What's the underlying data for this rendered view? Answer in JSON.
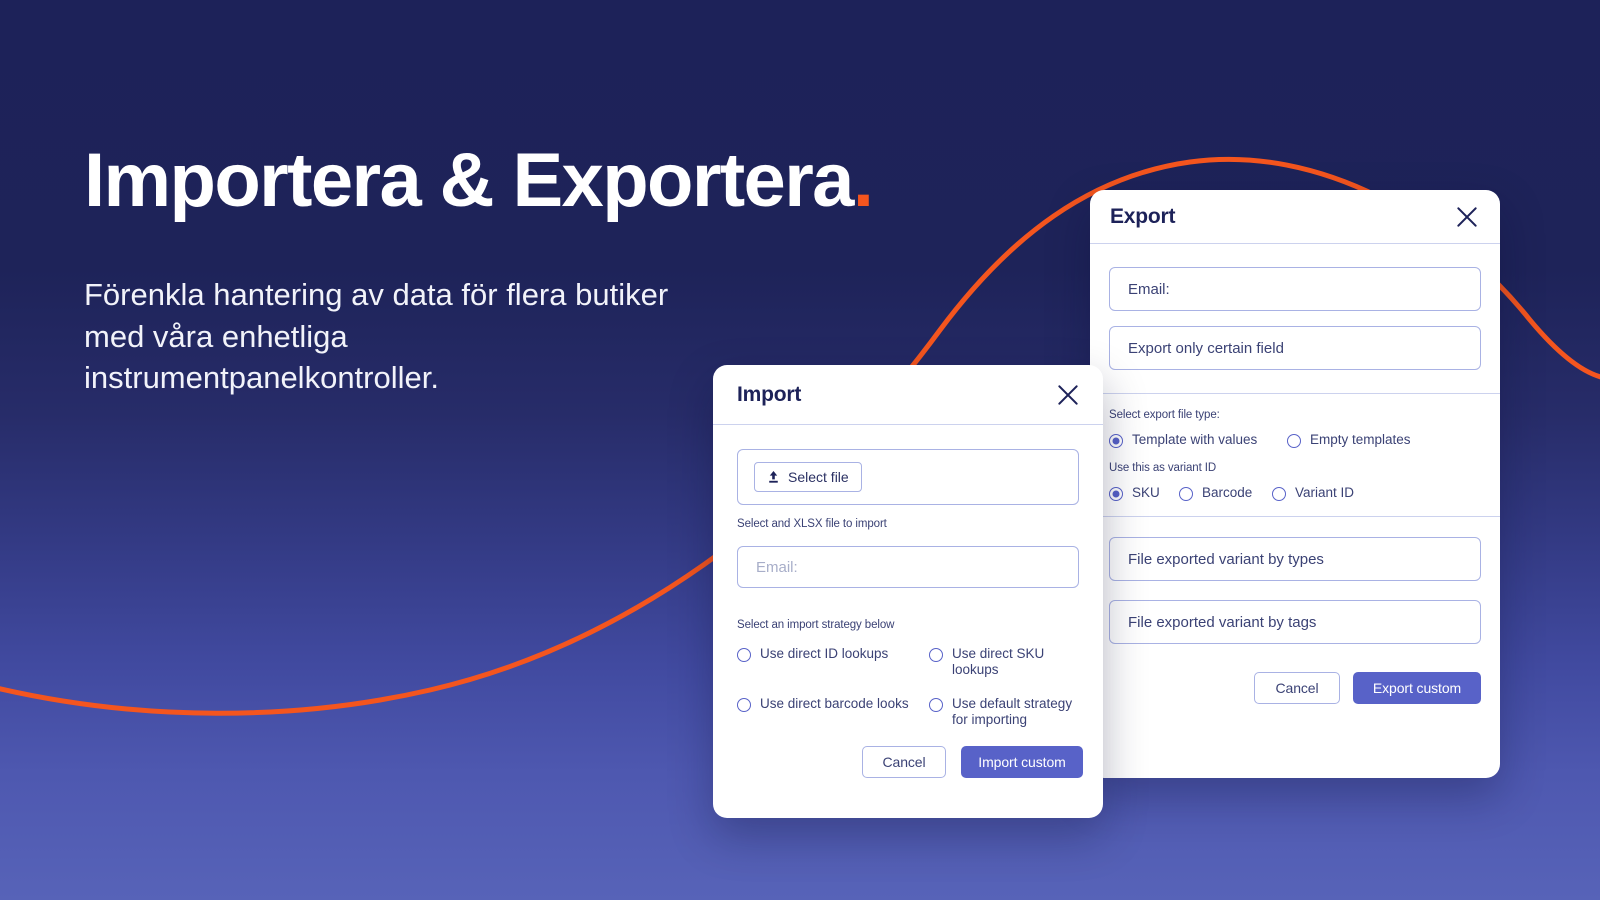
{
  "hero": {
    "headline": "Importera & Exportera",
    "headline_dot": ".",
    "subhead": "Förenkla hantering av data för flera butiker med våra enhetliga instrumentpanelkontroller."
  },
  "theme": {
    "background_top": "#1d2259",
    "background_bottom": "#5763b8",
    "accent_orange": "#f4551e",
    "primary_indigo": "#5862c8",
    "border_indigo": "#a9b2e4",
    "text_navy": "#1d2259"
  },
  "import_dialog": {
    "title": "Import",
    "close_icon": "close-icon",
    "select_file": {
      "icon": "upload-icon",
      "label": "Select file"
    },
    "file_hint": "Select and XLSX file to import",
    "email_placeholder": "Email:",
    "strategy_hint": "Select an import strategy below",
    "strategies": [
      {
        "label": "Use direct ID lookups",
        "selected": false
      },
      {
        "label": "Use direct SKU lookups",
        "selected": false
      },
      {
        "label": "Use direct barcode looks",
        "selected": false
      },
      {
        "label": "Use default strategy for importing",
        "selected": false
      }
    ],
    "cancel_label": "Cancel",
    "submit_label": "Import custom"
  },
  "export_dialog": {
    "title": "Export",
    "close_icon": "close-icon",
    "email_value": "Email:",
    "certain_field_value": "Export only certain field",
    "file_type_hint": "Select export file type:",
    "file_types": [
      {
        "label": "Template with values",
        "selected": true
      },
      {
        "label": "Empty templates",
        "selected": false
      }
    ],
    "variant_id_hint": "Use this as variant ID",
    "variant_ids": [
      {
        "label": "SKU",
        "selected": true
      },
      {
        "label": "Barcode",
        "selected": false
      },
      {
        "label": "Variant ID",
        "selected": false
      }
    ],
    "variant_by_types_value": "File exported variant by types",
    "variant_by_tags_value": "File exported variant by tags",
    "cancel_label": "Cancel",
    "submit_label": "Export custom"
  }
}
